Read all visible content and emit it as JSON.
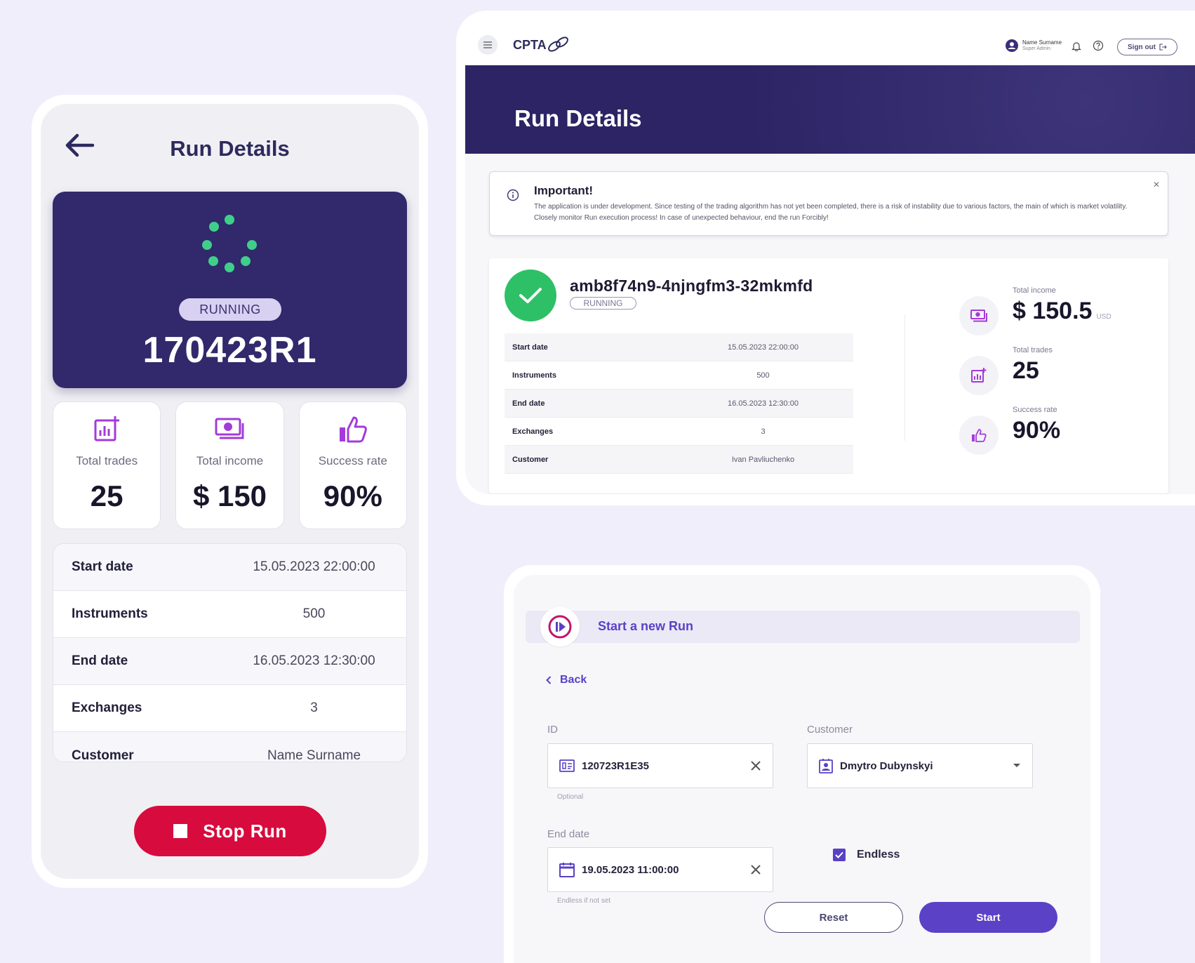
{
  "colors": {
    "background": "#f1eefb",
    "primary": "#31296b",
    "accent": "#5a41c5",
    "danger": "#d70b3d",
    "success": "#2ec066",
    "spinner": "#3fcf8a"
  },
  "mobile": {
    "title": "Run Details",
    "status": "RUNNING",
    "run_id": "170423R1",
    "stats": [
      {
        "label": "Total trades",
        "value": "25",
        "icon": "chart-add-icon"
      },
      {
        "label": "Total income",
        "value": "$ 150",
        "icon": "money-icon"
      },
      {
        "label": "Success rate",
        "value": "90%",
        "icon": "thumbs-up-icon"
      }
    ],
    "details": [
      {
        "key": "Start date",
        "value": "15.05.2023 22:00:00"
      },
      {
        "key": "Instruments",
        "value": "500"
      },
      {
        "key": "End date",
        "value": "16.05.2023 12:30:00"
      },
      {
        "key": "Exchanges",
        "value": "3"
      },
      {
        "key": "Customer",
        "value": "Name Surname"
      }
    ],
    "stop_label": "Stop Run"
  },
  "desktop": {
    "logo": "CPTA",
    "user": {
      "name": "Name Surname",
      "role": "Super Admin"
    },
    "signout_label": "Sign out",
    "page_title": "Run Details",
    "alert": {
      "title": "Important!",
      "text": "The application is under development. Since testing of the trading algorithm has not yet been completed, there is a risk of instability due to various factors, the main of which is market volatility. Closely monitor Run execution process! In case of unexpected behaviour, end the run Forcibly!"
    },
    "run": {
      "id": "amb8f74n9-4njngfm3-32mkmfd",
      "status": "RUNNING",
      "details": [
        {
          "key": "Start date",
          "value": "15.05.2023 22:00:00"
        },
        {
          "key": "Instruments",
          "value": "500"
        },
        {
          "key": "End date",
          "value": "16.05.2023 12:30:00"
        },
        {
          "key": "Exchanges",
          "value": "3"
        },
        {
          "key": "Customer",
          "value": "Ivan Pavliuchenko"
        }
      ],
      "stats": [
        {
          "label": "Total income",
          "value": "$ 150.5",
          "unit": "USD",
          "icon": "money-icon"
        },
        {
          "label": "Total trades",
          "value": "25",
          "unit": "",
          "icon": "chart-add-icon"
        },
        {
          "label": "Success rate",
          "value": "90%",
          "unit": "",
          "icon": "thumbs-up-icon"
        }
      ]
    }
  },
  "form": {
    "title": "Start a new Run",
    "back_label": "Back",
    "id_label": "ID",
    "id_value": "120723R1E35",
    "id_help": "Optional",
    "customer_label": "Customer",
    "customer_value": "Dmytro Dubynskyi",
    "end_date_label": "End date",
    "end_date_value": "19.05.2023 11:00:00",
    "end_date_help": "Endless if not set",
    "endless_label": "Endless",
    "endless_checked": true,
    "reset_label": "Reset",
    "start_label": "Start"
  }
}
